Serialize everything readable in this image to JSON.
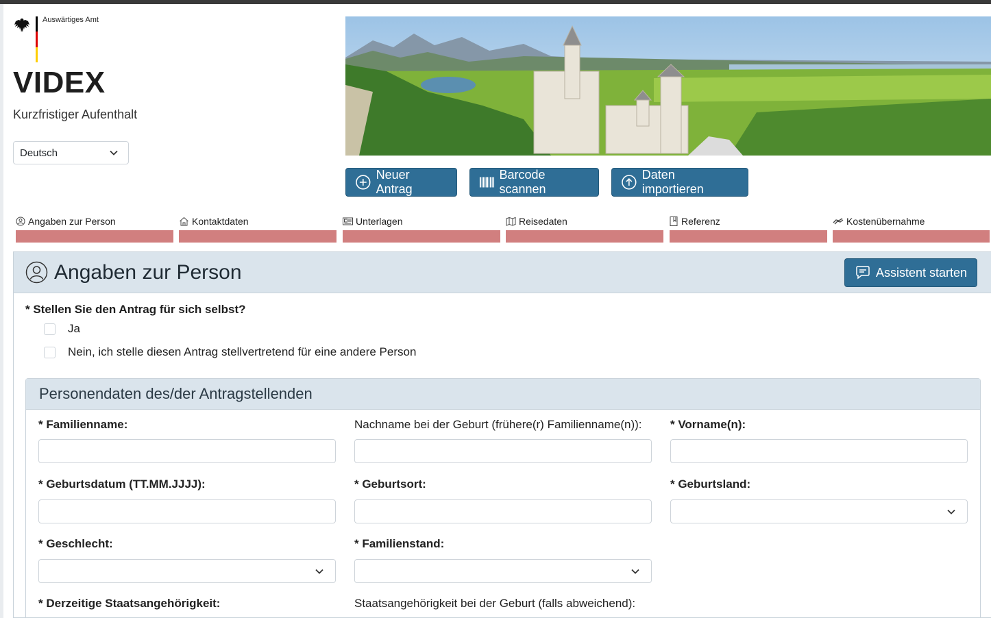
{
  "header": {
    "ministry": "Auswärtiges Amt",
    "app_title": "VIDEX",
    "app_subtitle": "Kurzfristiger Aufenthalt",
    "language": "Deutsch"
  },
  "actions": {
    "new_application": "Neuer Antrag",
    "scan_barcode": "Barcode scannen",
    "import_data": "Daten importieren"
  },
  "steps": [
    {
      "label": "Angaben zur Person",
      "icon": "person-circle-icon"
    },
    {
      "label": "Kontaktdaten",
      "icon": "house-icon"
    },
    {
      "label": "Unterlagen",
      "icon": "id-card-icon"
    },
    {
      "label": "Reisedaten",
      "icon": "map-icon"
    },
    {
      "label": "Referenz",
      "icon": "bookmark-icon"
    },
    {
      "label": "Kostenübernahme",
      "icon": "money-icon"
    }
  ],
  "section": {
    "title": "Angaben zur Person",
    "assistant_button": "Assistent starten",
    "question": "* Stellen Sie den Antrag für sich selbst?",
    "options": [
      "Ja",
      "Nein, ich stelle diesen Antrag stellvertretend für eine andere Person"
    ]
  },
  "personal": {
    "title": "Personendaten des/der Antragstellenden",
    "surname": "* Familienname:",
    "birth_name": "Nachname bei der Geburt (frühere(r) Familienname(n)):",
    "first_name": "* Vorname(n):",
    "birth_date": "* Geburtsdatum (TT.MM.JJJJ):",
    "birth_place": "* Geburtsort:",
    "birth_country": "* Geburtsland:",
    "gender": "* Geschlecht:",
    "marital_status": "* Familienstand:",
    "nationality": "* Derzeitige Staatsangehörigkeit:",
    "nationality_birth": "Staatsangehörigkeit bei der Geburt (falls abweichend):"
  },
  "colors": {
    "primary": "#2f6e96",
    "step_incomplete": "#d17f7f",
    "panel_header": "#dae4ec"
  }
}
